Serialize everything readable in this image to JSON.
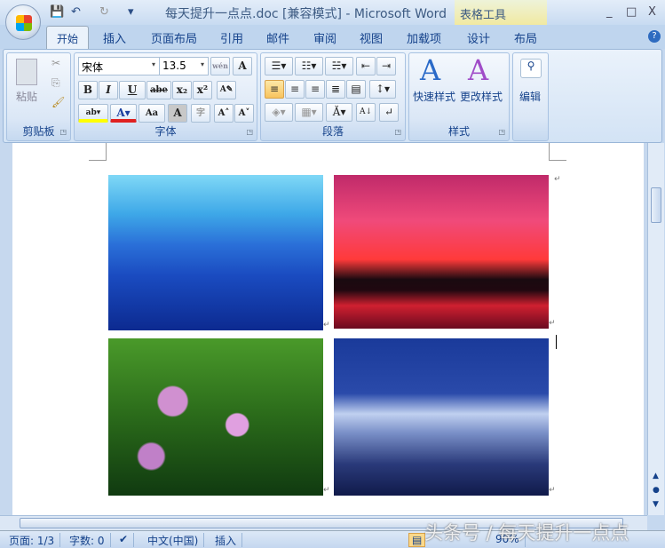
{
  "window": {
    "title": "每天提升一点点.doc [兼容模式] - Microsoft Word",
    "contextual_tab_group": "表格工具",
    "minimize": "_",
    "maximize": "□",
    "close": "X"
  },
  "quick_access": {
    "save": "save-icon",
    "undo": "↶",
    "redo": "↻",
    "customize": "▾"
  },
  "tabs": [
    "开始",
    "插入",
    "页面布局",
    "引用",
    "邮件",
    "审阅",
    "视图",
    "加载项",
    "设计",
    "布局"
  ],
  "help": "?",
  "ribbon": {
    "clipboard": {
      "label": "剪贴板",
      "paste": "粘贴"
    },
    "font": {
      "label": "字体",
      "font_name": "宋体",
      "font_size": "13.5",
      "bold": "B",
      "italic": "I",
      "underline": "U",
      "strike": "abe",
      "subscript": "x₂",
      "superscript": "x²",
      "change_case": "Aa",
      "char_shading": "A",
      "enclose": "字",
      "grow": "A˄",
      "shrink": "A˅",
      "phonetic": "wén",
      "border": "A",
      "highlight_color": "#ffff00",
      "font_color": "#e02020"
    },
    "paragraph": {
      "label": "段落"
    },
    "styles": {
      "label": "样式",
      "quick_styles": "快速样式",
      "change_styles": "更改样式"
    },
    "editing": {
      "label": "编辑"
    }
  },
  "status": {
    "page": "页面: 1/3",
    "words": "字数: 0",
    "language": "中文(中国)",
    "mode": "插入",
    "zoom": "90%"
  },
  "watermark": "头条号 / 每天提升一点点"
}
